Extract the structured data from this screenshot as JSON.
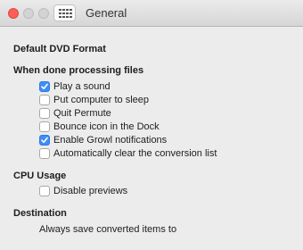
{
  "window": {
    "title": "General"
  },
  "sections": {
    "dvd_format": {
      "title": "Default DVD Format"
    },
    "when_done": {
      "title": "When done processing files",
      "options": [
        {
          "label": "Play a sound",
          "checked": true
        },
        {
          "label": "Put computer to sleep",
          "checked": false
        },
        {
          "label": "Quit Permute",
          "checked": false
        },
        {
          "label": "Bounce icon in the Dock",
          "checked": false
        },
        {
          "label": "Enable Growl notifications",
          "checked": true
        },
        {
          "label": "Automatically clear the conversion list",
          "checked": false
        }
      ]
    },
    "cpu_usage": {
      "title": "CPU Usage",
      "options": [
        {
          "label": "Disable previews",
          "checked": false
        }
      ]
    },
    "destination": {
      "title": "Destination",
      "text": "Always save converted items to"
    }
  },
  "colors": {
    "accent": "#3e8ef7",
    "close_button": "#fc5f57"
  },
  "icons": {
    "close": "close-icon",
    "minimize": "minimize-icon",
    "zoom": "zoom-icon",
    "show_all": "grid-icon",
    "checkmark": "checkmark-icon"
  }
}
